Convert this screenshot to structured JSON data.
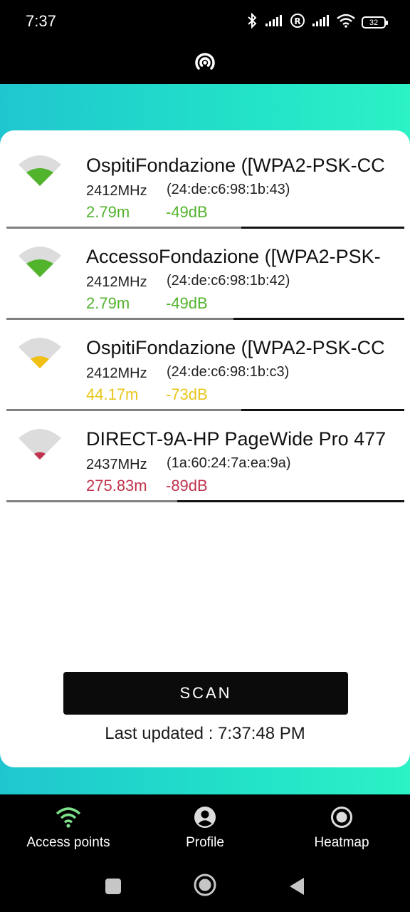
{
  "status_bar": {
    "time": "7:37",
    "battery": "32",
    "icons": [
      "bluetooth-icon",
      "signal-icon",
      "roaming-icon",
      "signal-icon",
      "wifi-icon",
      "battery-icon"
    ]
  },
  "header": {
    "logo_icon": "broadcast-icon"
  },
  "access_points": [
    {
      "ssid": "OspitiFondazione ([WPA2-PSK-CC",
      "frequency": "2412MHz",
      "bssid": "(24:de:c6:98:1b:43)",
      "distance": "2.79m",
      "signal": "-49dB",
      "strength": "good",
      "color": "#52b32c",
      "level": 0.59
    },
    {
      "ssid": "AccessoFondazione ([WPA2-PSK-",
      "frequency": "2412MHz",
      "bssid": "(24:de:c6:98:1b:42)",
      "distance": "2.79m",
      "signal": "-49dB",
      "strength": "good",
      "color": "#52b32c",
      "level": 0.57
    },
    {
      "ssid": "OspitiFondazione ([WPA2-PSK-CC",
      "frequency": "2412MHz",
      "bssid": "(24:de:c6:98:1b:c3)",
      "distance": "44.17m",
      "signal": "-73dB",
      "strength": "fair",
      "color": "#f0c015",
      "level": 0.59
    },
    {
      "ssid": "DIRECT-9A-HP PageWide Pro 477",
      "frequency": "2437MHz",
      "bssid": "(1a:60:24:7a:ea:9a)",
      "distance": "275.83m",
      "signal": "-89dB",
      "strength": "weak",
      "color": "#c0344d",
      "level": 0.43
    }
  ],
  "scan_button": "SCAN",
  "last_updated": "Last updated : 7:37:48 PM",
  "bottom_nav": [
    {
      "label": "Access points",
      "icon": "wifi-icon",
      "active": true,
      "color": "#7ee08a"
    },
    {
      "label": "Profile",
      "icon": "account-circle-icon",
      "active": false
    },
    {
      "label": "Heatmap",
      "icon": "radio-button-icon",
      "active": false
    }
  ],
  "system_nav": [
    "recent-apps-icon",
    "home-icon",
    "back-icon"
  ]
}
